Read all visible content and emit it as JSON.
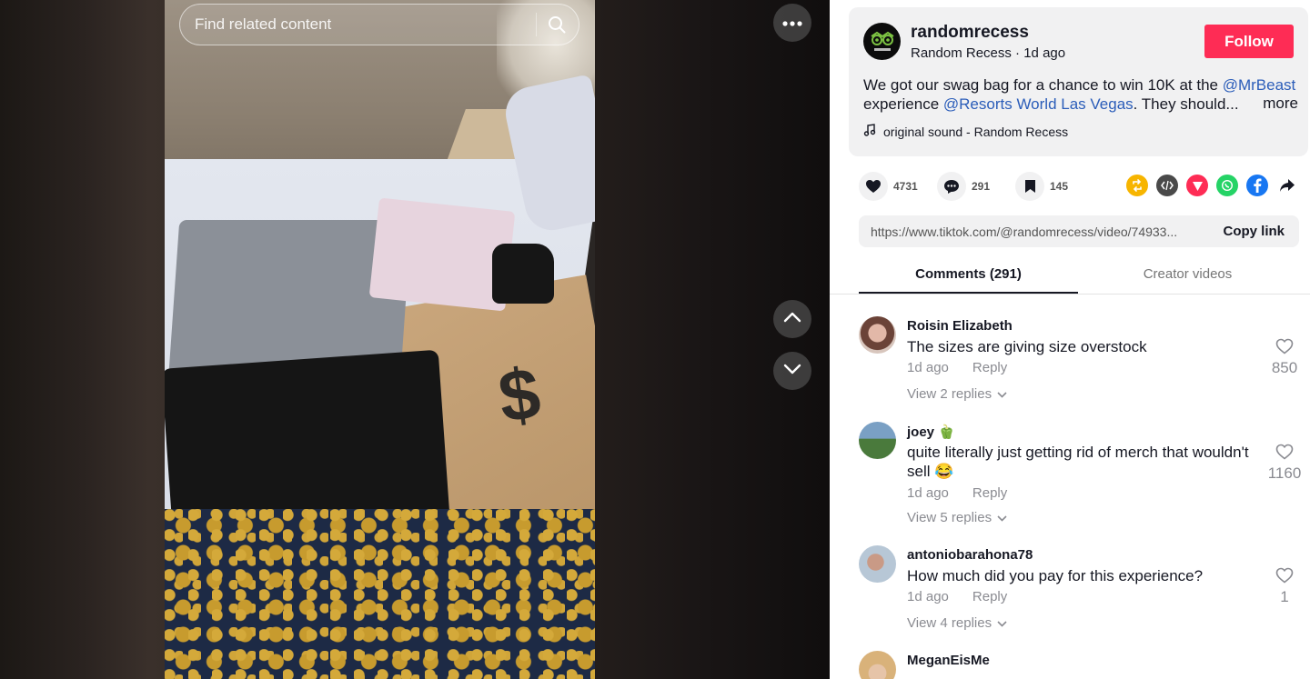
{
  "video": {
    "search_placeholder": "Find related content",
    "dollar_glyph": "$"
  },
  "author": {
    "username": "randomrecess",
    "display_meta": "Random Recess · 1d ago",
    "follow_label": "Follow",
    "description_part1": "We got our swag bag for a chance to win 10K at the ",
    "mention1": "@MrBeast",
    "description_part2": "experience ",
    "mention2": "@Resorts World Las Vegas",
    "description_part3": ". They should...",
    "more_label": "more",
    "sound": "original sound - Random Recess"
  },
  "actions": {
    "likes": "4731",
    "comments": "291",
    "saves": "145"
  },
  "share": {
    "colors": {
      "repost": "#f7b500",
      "embed": "#4a4a4a",
      "send": "#fe2c55",
      "whatsapp": "#25d366",
      "facebook": "#1877f2"
    }
  },
  "link": {
    "url": "https://www.tiktok.com/@randomrecess/video/74933...",
    "copy_label": "Copy link"
  },
  "tabs": {
    "comments": "Comments (291)",
    "creator": "Creator videos"
  },
  "comments": [
    {
      "user": "Roisin Elizabeth",
      "text": "The sizes are giving size overstock",
      "time": "1d ago",
      "reply": "Reply",
      "likes": "850",
      "replies": "View 2 replies"
    },
    {
      "user": "joey 🫑",
      "text": "quite literally just getting rid of merch that wouldn't sell 😂",
      "time": "1d ago",
      "reply": "Reply",
      "likes": "1160",
      "replies": "View 5 replies"
    },
    {
      "user": "antoniobarahona78",
      "text": "How much did you pay for this experience?",
      "time": "1d ago",
      "reply": "Reply",
      "likes": "1",
      "replies": "View 4 replies"
    },
    {
      "user": "MeganEisMe"
    }
  ]
}
